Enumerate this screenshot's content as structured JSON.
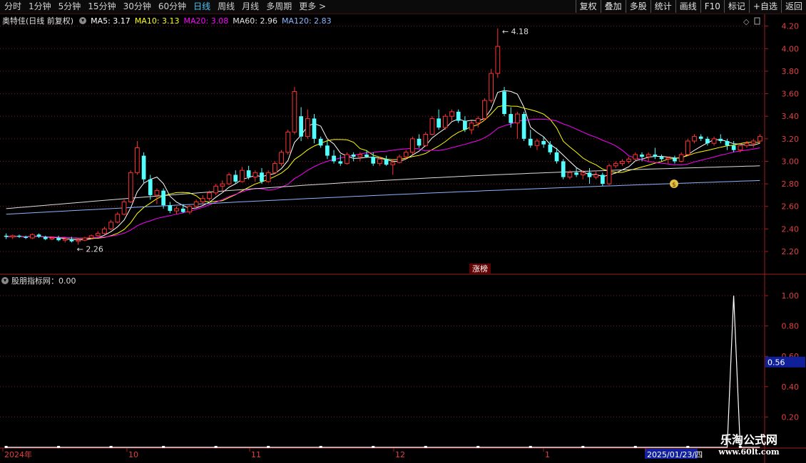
{
  "toolbar": {
    "periods": [
      "分时",
      "1分钟",
      "5分钟",
      "15分钟",
      "30分钟",
      "60分钟",
      "日线",
      "周线",
      "月线",
      "多周期",
      "更多 >"
    ],
    "active_period": "日线",
    "right_buttons": [
      "复权",
      "叠加",
      "多股",
      "统计",
      "画线",
      "F10",
      "标记",
      "+自选",
      "返回"
    ]
  },
  "legend": {
    "stock_name": "奥特佳(日线 前复权)",
    "ma5": "MA5: 3.17",
    "ma10": "MA10: 3.13",
    "ma20": "MA20: 3.08",
    "ma60": "MA60: 2.96",
    "ma120": "MA120: 2.83"
  },
  "indicator_legend": "股朋指标网：0.00",
  "colors": {
    "up": "#ff3232",
    "down": "#54ffff",
    "ma5": "#ffffff",
    "ma10": "#ffff00",
    "ma20": "#ff00ff",
    "ma60": "#dddddd",
    "ma120": "#8cb4ff",
    "grid": "#7a1a1a"
  },
  "icons": [
    "collapse-circle-icon",
    "diamond-icon",
    "scroll-icon",
    "money-bag-icon"
  ],
  "chart_data": [
    {
      "type": "candlestick",
      "y_ticks": [
        "4.20",
        "4.00",
        "3.80",
        "3.60",
        "3.40",
        "3.20",
        "3.00",
        "2.80",
        "2.60",
        "2.40",
        "2.20"
      ],
      "ylim": [
        2.08,
        4.28
      ],
      "annotations": {
        "high": "4.18",
        "low": "2.26",
        "event": "涨榜"
      },
      "x_labels": [
        "2024年",
        "10",
        "11",
        "12",
        "1",
        "2025/01/23/四"
      ],
      "ohlc": [
        [
          2.34,
          2.36,
          2.31,
          2.33
        ],
        [
          2.33,
          2.35,
          2.31,
          2.34
        ],
        [
          2.34,
          2.35,
          2.32,
          2.33
        ],
        [
          2.33,
          2.34,
          2.31,
          2.32
        ],
        [
          2.32,
          2.36,
          2.31,
          2.35
        ],
        [
          2.35,
          2.36,
          2.32,
          2.33
        ],
        [
          2.33,
          2.34,
          2.3,
          2.31
        ],
        [
          2.31,
          2.33,
          2.3,
          2.32
        ],
        [
          2.32,
          2.34,
          2.29,
          2.3
        ],
        [
          2.3,
          2.32,
          2.28,
          2.31
        ],
        [
          2.31,
          2.33,
          2.28,
          2.29
        ],
        [
          2.29,
          2.31,
          2.26,
          2.3
        ],
        [
          2.3,
          2.33,
          2.29,
          2.32
        ],
        [
          2.32,
          2.35,
          2.31,
          2.34
        ],
        [
          2.34,
          2.38,
          2.33,
          2.36
        ],
        [
          2.36,
          2.42,
          2.35,
          2.4
        ],
        [
          2.4,
          2.48,
          2.39,
          2.46
        ],
        [
          2.46,
          2.55,
          2.45,
          2.53
        ],
        [
          2.53,
          2.66,
          2.52,
          2.64
        ],
        [
          2.64,
          2.92,
          2.63,
          2.9
        ],
        [
          2.9,
          3.18,
          2.88,
          3.12
        ],
        [
          3.05,
          3.08,
          2.8,
          2.84
        ],
        [
          2.84,
          2.88,
          2.66,
          2.7
        ],
        [
          2.7,
          2.76,
          2.62,
          2.74
        ],
        [
          2.74,
          2.76,
          2.58,
          2.61
        ],
        [
          2.61,
          2.64,
          2.54,
          2.56
        ],
        [
          2.56,
          2.6,
          2.53,
          2.58
        ],
        [
          2.58,
          2.62,
          2.54,
          2.55
        ],
        [
          2.55,
          2.61,
          2.53,
          2.6
        ],
        [
          2.6,
          2.66,
          2.59,
          2.64
        ],
        [
          2.64,
          2.7,
          2.61,
          2.67
        ],
        [
          2.67,
          2.74,
          2.65,
          2.72
        ],
        [
          2.72,
          2.8,
          2.7,
          2.78
        ],
        [
          2.78,
          2.83,
          2.74,
          2.8
        ],
        [
          2.8,
          2.9,
          2.79,
          2.88
        ],
        [
          2.88,
          2.92,
          2.8,
          2.82
        ],
        [
          2.82,
          2.95,
          2.81,
          2.92
        ],
        [
          2.92,
          2.96,
          2.84,
          2.86
        ],
        [
          2.86,
          2.92,
          2.82,
          2.9
        ],
        [
          2.9,
          2.94,
          2.8,
          2.82
        ],
        [
          2.82,
          2.92,
          2.81,
          2.9
        ],
        [
          2.9,
          3.0,
          2.89,
          2.98
        ],
        [
          2.98,
          3.1,
          2.96,
          3.08
        ],
        [
          3.08,
          3.28,
          3.06,
          3.26
        ],
        [
          3.26,
          3.66,
          3.24,
          3.62
        ],
        [
          3.4,
          3.48,
          3.18,
          3.22
        ],
        [
          3.22,
          3.46,
          3.2,
          3.38
        ],
        [
          3.38,
          3.42,
          3.16,
          3.2
        ],
        [
          3.2,
          3.22,
          3.12,
          3.14
        ],
        [
          3.14,
          3.18,
          3.02,
          3.05
        ],
        [
          3.05,
          3.1,
          2.98,
          3.0
        ],
        [
          3.0,
          3.06,
          2.96,
          2.98
        ],
        [
          2.98,
          3.08,
          2.97,
          3.06
        ],
        [
          3.06,
          3.08,
          3.0,
          3.04
        ],
        [
          3.04,
          3.08,
          3.0,
          3.06
        ],
        [
          3.06,
          3.1,
          3.03,
          3.04
        ],
        [
          3.04,
          3.08,
          2.96,
          2.98
        ],
        [
          2.98,
          3.04,
          2.96,
          3.02
        ],
        [
          3.02,
          3.05,
          2.96,
          2.97
        ],
        [
          2.97,
          3.02,
          2.88,
          2.99
        ],
        [
          2.99,
          3.06,
          2.98,
          3.04
        ],
        [
          3.04,
          3.1,
          3.02,
          3.08
        ],
        [
          3.08,
          3.22,
          3.06,
          3.2
        ],
        [
          3.2,
          3.24,
          3.12,
          3.14
        ],
        [
          3.14,
          3.26,
          3.13,
          3.24
        ],
        [
          3.24,
          3.4,
          3.23,
          3.38
        ],
        [
          3.38,
          3.46,
          3.28,
          3.3
        ],
        [
          3.3,
          3.42,
          3.28,
          3.4
        ],
        [
          3.4,
          3.46,
          3.36,
          3.44
        ],
        [
          3.44,
          3.46,
          3.34,
          3.36
        ],
        [
          3.36,
          3.4,
          3.26,
          3.28
        ],
        [
          3.28,
          3.36,
          3.24,
          3.34
        ],
        [
          3.34,
          3.4,
          3.3,
          3.38
        ],
        [
          3.38,
          3.56,
          3.36,
          3.54
        ],
        [
          3.54,
          3.82,
          3.52,
          3.78
        ],
        [
          3.78,
          4.18,
          3.74,
          4.02
        ],
        [
          3.62,
          3.66,
          3.4,
          3.42
        ],
        [
          3.42,
          3.48,
          3.3,
          3.34
        ],
        [
          3.34,
          3.44,
          3.2,
          3.42
        ],
        [
          3.42,
          3.44,
          3.18,
          3.2
        ],
        [
          3.2,
          3.28,
          3.12,
          3.14
        ],
        [
          3.14,
          3.2,
          3.1,
          3.18
        ],
        [
          3.18,
          3.22,
          3.12,
          3.15
        ],
        [
          3.15,
          3.18,
          3.06,
          3.08
        ],
        [
          3.08,
          3.12,
          2.98,
          3.0
        ],
        [
          3.0,
          3.02,
          2.84,
          2.86
        ],
        [
          2.86,
          2.92,
          2.84,
          2.9
        ],
        [
          2.9,
          2.94,
          2.86,
          2.88
        ],
        [
          2.88,
          2.92,
          2.84,
          2.9
        ],
        [
          2.9,
          2.94,
          2.8,
          2.86
        ],
        [
          2.86,
          2.92,
          2.84,
          2.88
        ],
        [
          2.88,
          2.9,
          2.78,
          2.8
        ],
        [
          2.8,
          2.98,
          2.79,
          2.96
        ],
        [
          2.96,
          3.0,
          2.94,
          2.98
        ],
        [
          2.98,
          3.02,
          2.96,
          3.0
        ],
        [
          3.0,
          3.04,
          2.98,
          3.02
        ],
        [
          3.02,
          3.08,
          3.01,
          3.06
        ],
        [
          3.06,
          3.08,
          3.0,
          3.04
        ],
        [
          3.04,
          3.08,
          3.0,
          3.06
        ],
        [
          3.06,
          3.12,
          3.02,
          3.04
        ],
        [
          3.04,
          3.06,
          3.0,
          3.02
        ],
        [
          3.02,
          3.04,
          2.98,
          3.03
        ],
        [
          3.03,
          3.05,
          2.98,
          3.0
        ],
        [
          3.0,
          3.08,
          2.99,
          3.06
        ],
        [
          3.06,
          3.2,
          3.05,
          3.18
        ],
        [
          3.18,
          3.24,
          3.16,
          3.22
        ],
        [
          3.22,
          3.24,
          3.18,
          3.2
        ],
        [
          3.2,
          3.22,
          3.14,
          3.16
        ],
        [
          3.16,
          3.22,
          3.14,
          3.2
        ],
        [
          3.2,
          3.24,
          3.16,
          3.18
        ],
        [
          3.18,
          3.2,
          3.1,
          3.14
        ],
        [
          3.14,
          3.18,
          3.08,
          3.1
        ],
        [
          3.1,
          3.16,
          3.08,
          3.14
        ],
        [
          3.14,
          3.18,
          3.12,
          3.16
        ],
        [
          3.16,
          3.2,
          3.12,
          3.18
        ],
        [
          3.18,
          3.24,
          3.16,
          3.22
        ]
      ],
      "ma60_start": 2.58,
      "ma60_end": 2.96,
      "ma120_start": 2.53,
      "ma120_end": 2.83
    },
    {
      "type": "line",
      "y_ticks": [
        "1.00",
        "0.80",
        "0.60",
        "0.40",
        "0.20"
      ],
      "ylim": [
        0,
        1.08
      ],
      "current_value_label": "0.56",
      "spike_index": 111,
      "values_default": 0
    }
  ],
  "watermark": {
    "line1": "乐淘公式网",
    "line2": "www.60lt.com"
  }
}
